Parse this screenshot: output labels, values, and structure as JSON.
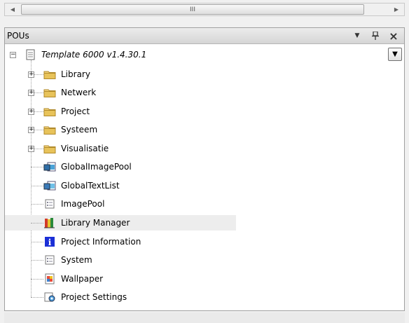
{
  "scrollbar": {
    "left_arrow": "◀",
    "right_arrow": "▶",
    "grip": "III"
  },
  "panel": {
    "title": "POUs",
    "menu_glyph": "▼",
    "pin_glyph": "ᵖ",
    "close_glyph": "×",
    "dropdown_glyph": "▼"
  },
  "tree": {
    "root": {
      "label": "Template 6000 v1.4.30.1",
      "expander": "−",
      "icon": "document-icon"
    },
    "items": [
      {
        "label": "Library",
        "icon": "folder-icon",
        "expander": "+"
      },
      {
        "label": "Netwerk",
        "icon": "folder-icon",
        "expander": "+"
      },
      {
        "label": "Project",
        "icon": "folder-icon",
        "expander": "+"
      },
      {
        "label": "Systeem",
        "icon": "folder-icon",
        "expander": "+"
      },
      {
        "label": "Visualisatie",
        "icon": "folder-icon",
        "expander": "+"
      },
      {
        "label": "GlobalImagePool",
        "icon": "image-pool-icon"
      },
      {
        "label": "GlobalTextList",
        "icon": "text-list-icon"
      },
      {
        "label": "ImagePool",
        "icon": "list-icon"
      },
      {
        "label": "Library Manager",
        "icon": "books-icon",
        "selected": true
      },
      {
        "label": "Project Information",
        "icon": "info-icon"
      },
      {
        "label": "System",
        "icon": "list-icon"
      },
      {
        "label": "Wallpaper",
        "icon": "wallpaper-icon"
      },
      {
        "label": "Project Settings",
        "icon": "settings-icon"
      }
    ]
  },
  "colors": {
    "folder": "#e8c35a",
    "info_blue": "#1b2fd6",
    "selection": "#ededed",
    "header_bg": "#dcdcdc"
  }
}
